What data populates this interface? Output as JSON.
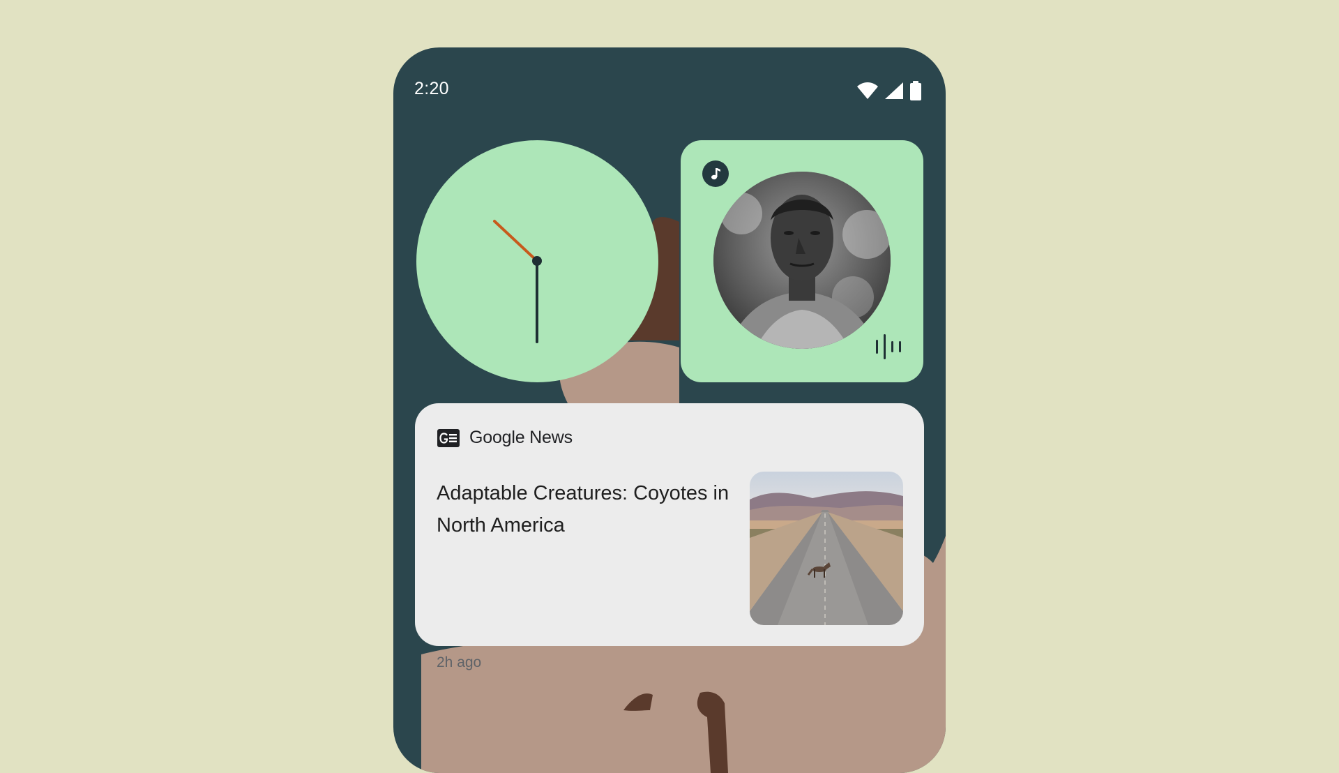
{
  "status_bar": {
    "time": "2:20",
    "icons": [
      "wifi-icon",
      "cellular-signal-icon",
      "battery-icon"
    ]
  },
  "clock_widget": {
    "hour_hand_color": "#c75a1c",
    "minute_hand_color": "#1e2f33",
    "face_color": "#ade6b8"
  },
  "music_widget": {
    "note_icon": "music-note-icon",
    "equalizer_icon": "equalizer-icon",
    "background_color": "#ade6b8"
  },
  "news_card": {
    "source": "Google News",
    "headline": "Adaptable Creatures: Coyotes in North America",
    "time_ago": "2h ago",
    "logo_icon": "google-news-logo-icon"
  },
  "colors": {
    "page_background": "#e1e2c2",
    "phone_background": "#2b464d",
    "card_background": "#ececec",
    "widget_green": "#ade6b8"
  }
}
